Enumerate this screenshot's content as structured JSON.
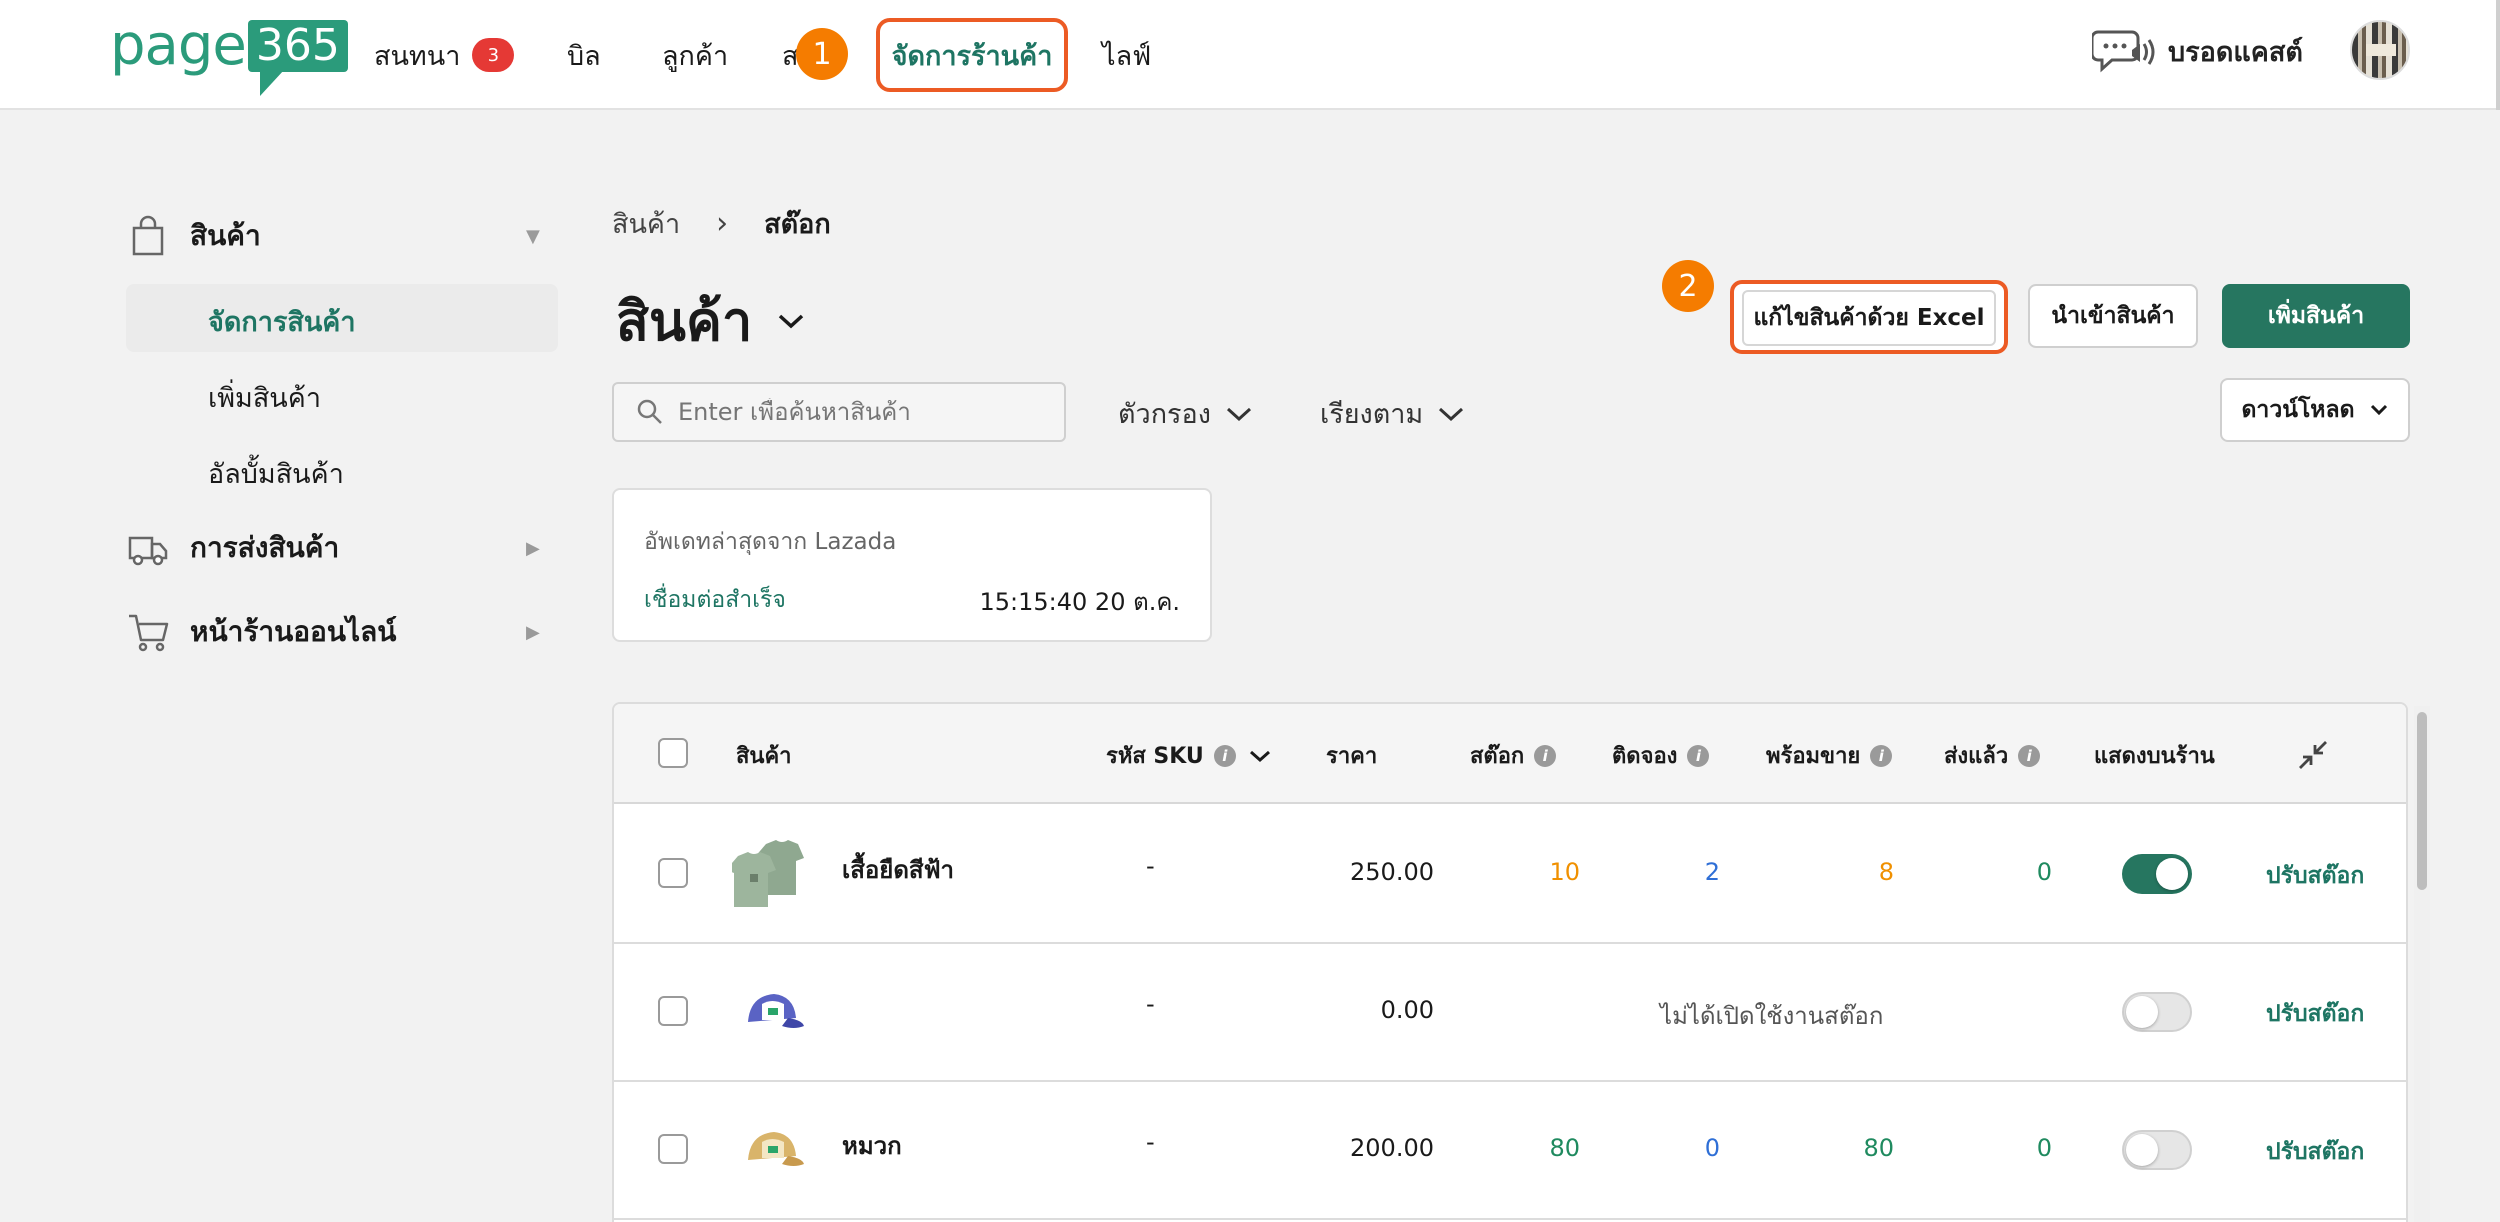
{
  "header": {
    "logo_page": "page",
    "logo_num": "365",
    "nav": {
      "chat": "สนทนา",
      "chat_badge": "3",
      "bill": "บิล",
      "customers": "ลูกค้า",
      "partial": "ส",
      "manage_store": "จัดการร้านค้า",
      "live": "ไลฟ์"
    },
    "step1": "1",
    "broadcast_label": "บรอดแคสต์"
  },
  "sidebar": {
    "products": "สินค้า",
    "sub": [
      "จัดการสินค้า",
      "เพิ่มสินค้า",
      "อัลบั้มสินค้า"
    ],
    "shipping": "การส่งสินค้า",
    "storefront": "หน้าร้านออนไลน์"
  },
  "main": {
    "breadcrumb": [
      "สินค้า",
      "สต๊อก"
    ],
    "title": "สินค้า",
    "step2": "2",
    "btn_excel": "แก้ไขสินค้าด้วย Excel",
    "btn_import": "นำเข้าสินค้า",
    "btn_add": "เพิ่มสินค้า",
    "btn_download": "ดาวน์โหลด",
    "search_placeholder": "Enter เพื่อค้นหาสินค้า",
    "filter": "ตัวกรอง",
    "sort": "เรียงตาม",
    "sync_card": {
      "title": "อัพเดทล่าสุดจาก Lazada",
      "status": "เชื่อมต่อสำเร็จ",
      "time": "15:15:40 20 ต.ค."
    }
  },
  "table": {
    "headers": {
      "product": "สินค้า",
      "sku": "รหัส SKU",
      "price": "ราคา",
      "stock": "สต๊อก",
      "reserved": "ติดจอง",
      "available": "พร้อมขาย",
      "shipped": "ส่งแล้ว",
      "show": "แสดงบนร้าน"
    },
    "adjust_label": "ปรับสต๊อก",
    "stock_disabled": "ไม่ได้เปิดใช้งานสต๊อก",
    "rows": [
      {
        "name": "เสื้อยืดสีฟ้า",
        "sku": "-",
        "price": "250.00",
        "stock": "10",
        "reserved": "2",
        "available": "8",
        "shipped": "0",
        "show": true
      },
      {
        "name": "",
        "sku": "-",
        "price": "0.00",
        "show": false
      },
      {
        "name": "หมวก",
        "sku": "-",
        "price": "200.00",
        "stock": "80",
        "reserved": "0",
        "available": "80",
        "shipped": "0",
        "show": false
      }
    ]
  },
  "colors": {
    "brand_green": "#267660",
    "highlight_orange": "#ec5b24",
    "step_orange": "#f57c00",
    "badge_red": "#e53935",
    "stock_orange": "#f09000",
    "reserved_blue": "#2f6fd6",
    "value_green": "#1f8a5f"
  }
}
